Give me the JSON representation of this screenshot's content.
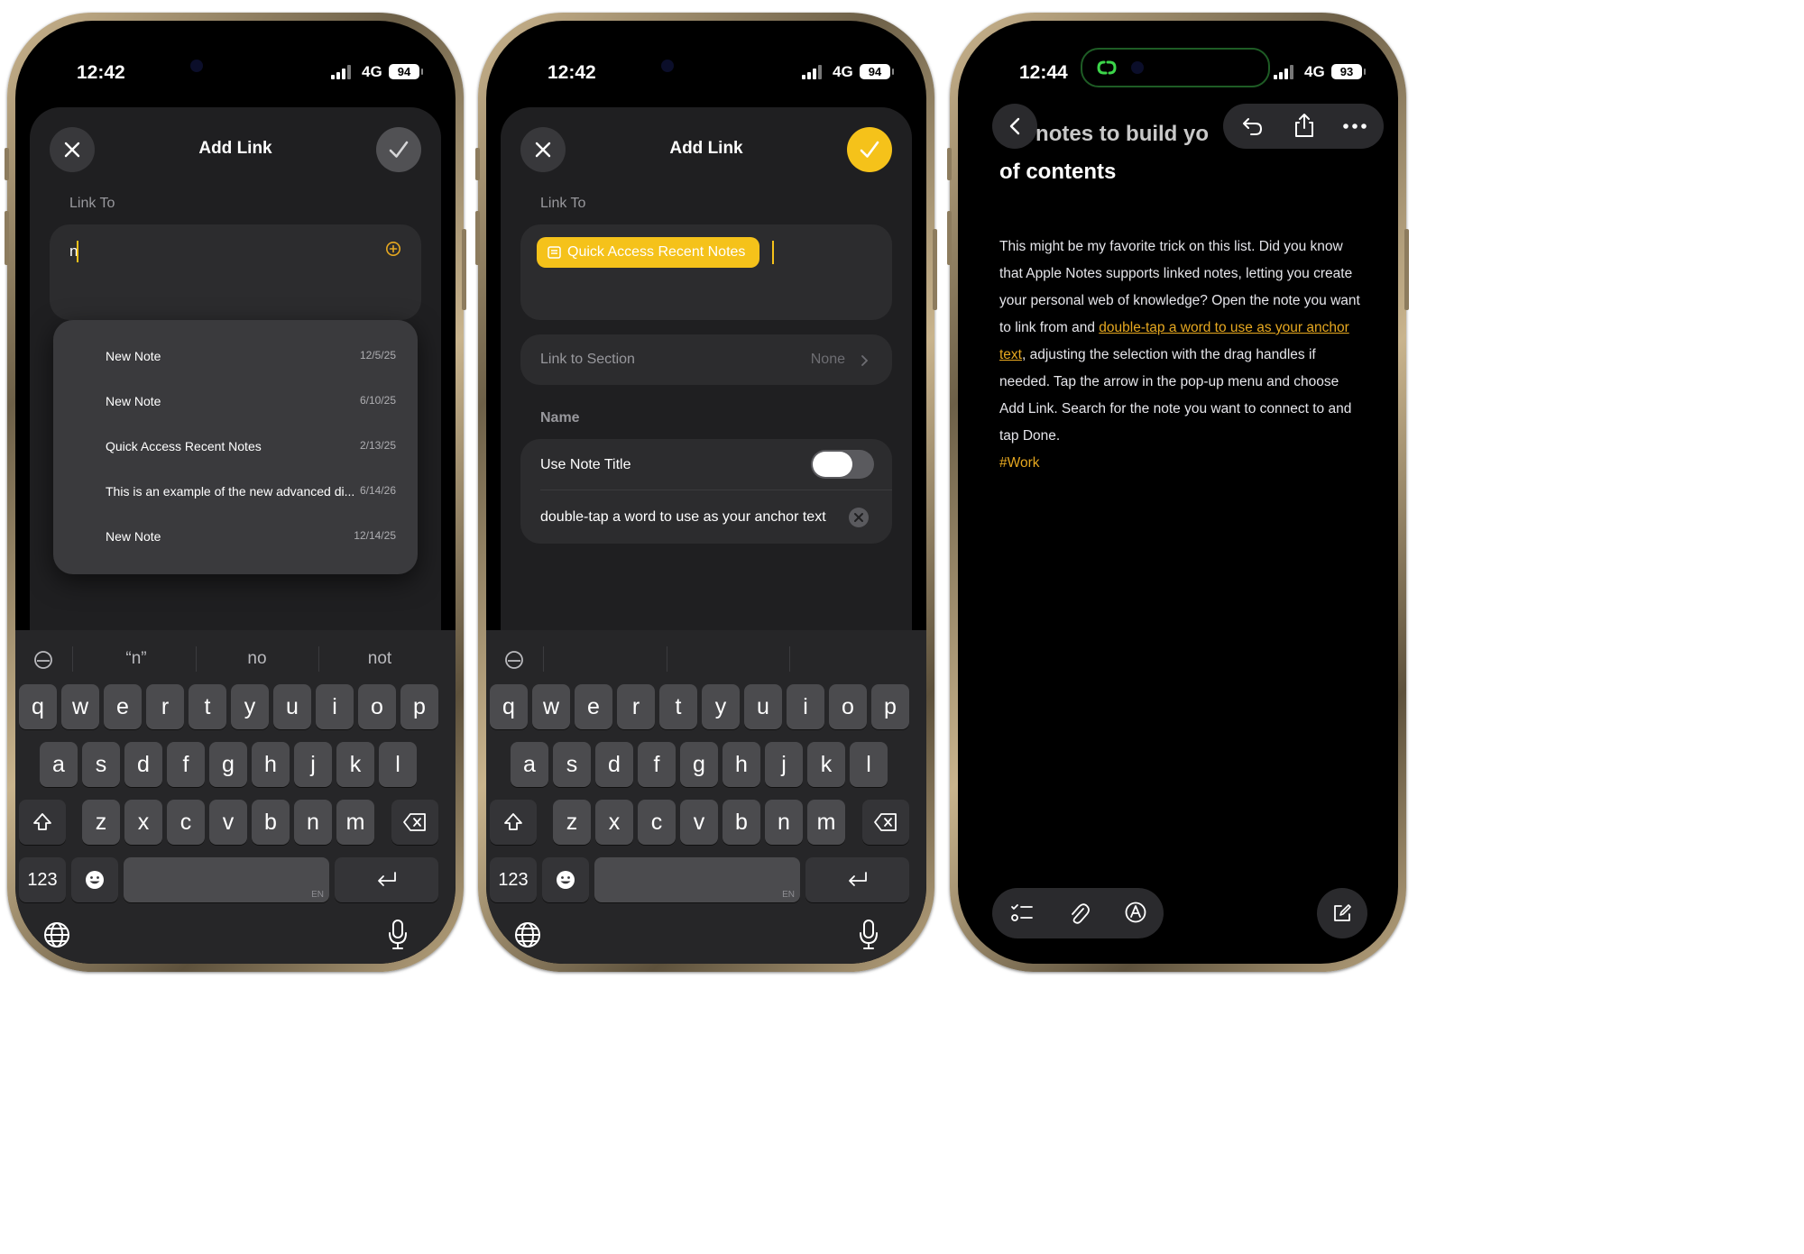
{
  "phone1": {
    "status": {
      "time": "12:42",
      "network": "4G",
      "battery": "94"
    },
    "header": {
      "title": "Add Link"
    },
    "link_to": {
      "label": "Link To",
      "typed_value": "n"
    },
    "results": [
      {
        "title": "New Note",
        "date": "12/5/25"
      },
      {
        "title": "New Note",
        "date": "6/10/25"
      },
      {
        "title": "Quick Access Recent Notes",
        "date": "2/13/25"
      },
      {
        "title": "This is an example of the new advanced di...",
        "date": "6/14/26"
      },
      {
        "title": "New Note",
        "date": "12/14/25"
      }
    ],
    "suggestions": [
      "“n”",
      "no",
      "not"
    ]
  },
  "phone2": {
    "status": {
      "time": "12:42",
      "network": "4G",
      "battery": "94"
    },
    "header": {
      "title": "Add Link"
    },
    "link_to": {
      "label": "Link To",
      "chip": "Quick Access Recent Notes"
    },
    "section": {
      "label": "Link to Section",
      "value": "None"
    },
    "name": {
      "label": "Name",
      "use_note_title": "Use Note Title",
      "use_note_title_on": true,
      "anchor_text": "double-tap a word to use as your anchor text"
    }
  },
  "keyboard": {
    "row1": [
      "q",
      "w",
      "e",
      "r",
      "t",
      "y",
      "u",
      "i",
      "o",
      "p"
    ],
    "row2": [
      "a",
      "s",
      "d",
      "f",
      "g",
      "h",
      "j",
      "k",
      "l"
    ],
    "row3": [
      "z",
      "x",
      "c",
      "v",
      "b",
      "n",
      "m"
    ],
    "numbers_label": "123",
    "space_lang": "EN"
  },
  "phone3": {
    "status": {
      "time": "12:44",
      "network": "4G",
      "battery": "93"
    },
    "title_line1": "ick notes to build yo",
    "title_line2": "of contents",
    "body": {
      "p1": "This might be my favorite trick on this list. Did you know that Apple Notes supports linked notes, letting you create your personal web of knowledge? Open the note you want to link from and ",
      "link": "double-tap a word to use as your anchor text",
      "p2": ", adjusting the selection with the drag handles if needed. Tap the arrow in the pop-up menu and choose Add Link. Search for the note you want to connect to and tap Done.",
      "tag": "#Work"
    }
  },
  "colors": {
    "accent": "#f5c21a",
    "link": "#e6a820",
    "sheet": "#1f1f21",
    "card": "#2c2c2e",
    "dynamic_island_link": "#3cd54a"
  }
}
